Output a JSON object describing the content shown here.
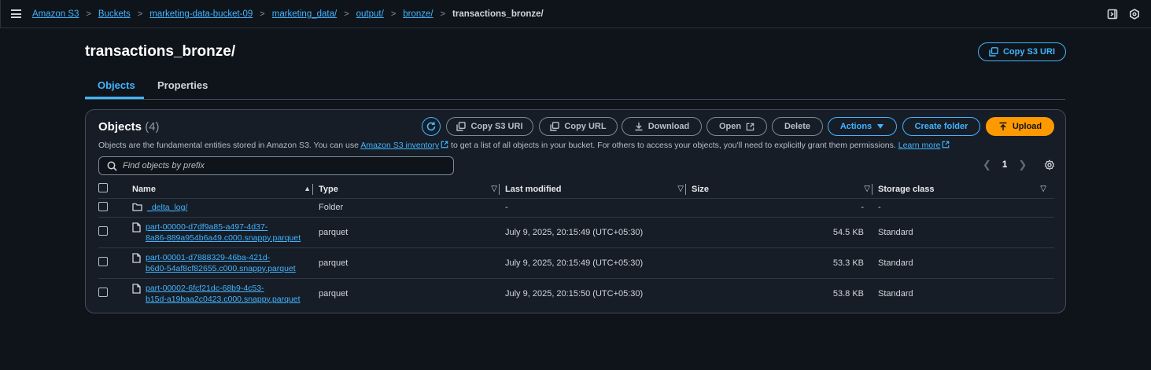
{
  "breadcrumb": [
    "Amazon S3",
    "Buckets",
    "marketing-data-bucket-09",
    "marketing_data/",
    "output/",
    "bronze/"
  ],
  "breadcrumb_current": "transactions_bronze/",
  "page": {
    "title": "transactions_bronze/",
    "copy_uri_label": "Copy S3 URI"
  },
  "tabs": [
    "Objects",
    "Properties"
  ],
  "panel": {
    "title": "Objects",
    "count": "(4)",
    "desc_pre": "Objects are the fundamental entities stored in Amazon S3. You can use ",
    "desc_link1": "Amazon S3 inventory",
    "desc_mid": " to get a list of all objects in your bucket. For others to access your objects, you'll need to explicitly grant them permissions. ",
    "desc_link2": "Learn more"
  },
  "toolbar": {
    "copy_s3_uri": "Copy S3 URI",
    "copy_url": "Copy URL",
    "download": "Download",
    "open": "Open",
    "delete": "Delete",
    "actions": "Actions",
    "create_folder": "Create folder",
    "upload": "Upload"
  },
  "search": {
    "placeholder": "Find objects by prefix"
  },
  "pager": {
    "page": "1"
  },
  "columns": [
    "Name",
    "Type",
    "Last modified",
    "Size",
    "Storage class"
  ],
  "rows": [
    {
      "name1": "_delta_log/",
      "name2": "",
      "type": "Folder",
      "modified": "-",
      "size": "-",
      "storage": "-"
    },
    {
      "name1": "part-00000-d7df9a85-a497-4d37-",
      "name2": "8a86-889a954b6a49.c000.snappy.parquet",
      "type": "parquet",
      "modified": "July 9, 2025, 20:15:49 (UTC+05:30)",
      "size": "54.5 KB",
      "storage": "Standard"
    },
    {
      "name1": "part-00001-d7888329-46ba-421d-",
      "name2": "b6d0-54af8cf82655.c000.snappy.parquet",
      "type": "parquet",
      "modified": "July 9, 2025, 20:15:49 (UTC+05:30)",
      "size": "53.3 KB",
      "storage": "Standard"
    },
    {
      "name1": "part-00002-6fcf21dc-68b9-4c53-",
      "name2": "b15d-a19baa2c0423.c000.snappy.parquet",
      "type": "parquet",
      "modified": "July 9, 2025, 20:15:50 (UTC+05:30)",
      "size": "53.8 KB",
      "storage": "Standard"
    }
  ]
}
